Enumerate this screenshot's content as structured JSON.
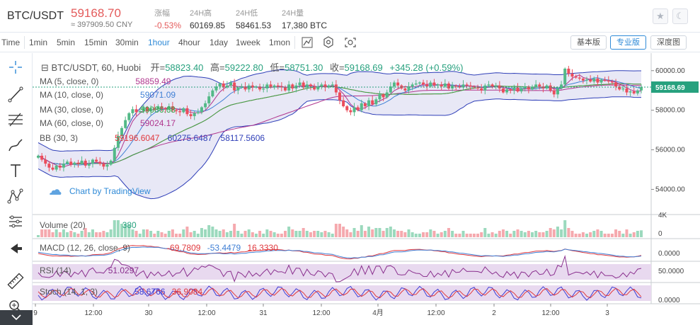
{
  "header": {
    "pair": "BTC/USDT",
    "last_price": "59168.70",
    "cny_price": "≈ 397909.50 CNY",
    "stats": [
      {
        "label": "涨幅",
        "value": "-0.53%"
      },
      {
        "label": "24H高",
        "value": "60169.85"
      },
      {
        "label": "24H低",
        "value": "58461.53"
      },
      {
        "label": "24H量",
        "value": "17,380 BTC"
      }
    ],
    "favorite_icon": "star-icon",
    "theme_icon": "moon-icon"
  },
  "toolbar": {
    "timeframes": [
      "Time",
      "1min",
      "5min",
      "15min",
      "30min",
      "1hour",
      "4hour",
      "1day",
      "1week",
      "1mon"
    ],
    "active_timeframe": "1hour",
    "icons": [
      "chart-type-icon",
      "settings-icon",
      "screenshot-icon"
    ],
    "views": [
      "基本版",
      "专业版",
      "深度图"
    ],
    "active_view": "专业版"
  },
  "left_tools": [
    "crosshair-icon",
    "trendline-icon",
    "fib-icon",
    "brush-icon",
    "text-icon",
    "pattern-icon",
    "measure-icon",
    "arrow-left-icon",
    "ruler-icon",
    "zoom-icon"
  ],
  "main_legend": {
    "symbol": "BTC/USDT, 60, Huobi",
    "open_label": "开=",
    "open": "58823.40",
    "high_label": "高=",
    "high": "59222.80",
    "low_label": "低=",
    "low": "58751.30",
    "close_label": "收=",
    "close": "59168.69",
    "change": "+345.28 (+0.59%)"
  },
  "indicators": [
    {
      "name": "MA (5, close, 0)",
      "values": [
        "58859.49"
      ],
      "colors": [
        "#b0368e"
      ]
    },
    {
      "name": "MA (10, close, 0)",
      "values": [
        "59071.09"
      ],
      "colors": [
        "#3f7fd5"
      ]
    },
    {
      "name": "MA (30, close, 0)",
      "values": [
        "59086.68"
      ],
      "colors": [
        "#38a84a"
      ]
    },
    {
      "name": "MA (60, close, 0)",
      "values": [
        "59024.17"
      ],
      "colors": [
        "#b0368e"
      ]
    },
    {
      "name": "BB (30, 3)",
      "values": [
        "59196.6047",
        "60275.6487",
        "58117.5606"
      ],
      "colors": [
        "#e0393e",
        "#2f3fb8",
        "#2f3fb8"
      ]
    }
  ],
  "watermark": "Chart by TradingView",
  "price_axis": {
    "ticks": [
      "60000.00",
      "58000.00",
      "56000.00",
      "54000.00"
    ],
    "current": "59168.69"
  },
  "sub_panes": [
    {
      "name": "Volume (20)",
      "values": [
        "380"
      ],
      "colors": [
        "#27a17e"
      ],
      "axis": [
        "4K",
        "0"
      ]
    },
    {
      "name": "MACD (12, 26, close, 9)",
      "values": [
        "-69.7809",
        "-53.4479",
        "16.3330"
      ],
      "colors": [
        "#e0393e",
        "#3f7fd5",
        "#e0393e"
      ],
      "axis": [
        "0.0000"
      ]
    },
    {
      "name": "RSI (14)",
      "values": [
        "51.0297"
      ],
      "colors": [
        "#8a2f8e"
      ],
      "axis": [
        "50.0000"
      ]
    },
    {
      "name": "Stoch (14, 1, 3)",
      "values": [
        "58.6766",
        "36.9084"
      ],
      "colors": [
        "#3f3fd5",
        "#e0393e"
      ],
      "axis": [
        "0.0000"
      ]
    }
  ],
  "time_axis": [
    "9",
    "12:00",
    "30",
    "12:00",
    "31",
    "12:00",
    "4月",
    "12:00",
    "2",
    "12:00",
    "3"
  ],
  "colors": {
    "up": "#53b987",
    "down": "#eb4d5c",
    "accent": "#2f8ad7",
    "bb_fill": "#d8d8f0"
  },
  "chart_data": {
    "type": "candlestick",
    "interval": "1hour",
    "price_range": [
      52800,
      60600
    ],
    "close_series": [
      55700,
      55500,
      55300,
      55100,
      55000,
      55200,
      55100,
      55300,
      55400,
      55250,
      55350,
      55300,
      55450,
      55200,
      55300,
      55500,
      55400,
      55300,
      55150,
      55250,
      55450,
      56100,
      56700,
      57100,
      57500,
      57850,
      58050,
      57900,
      57950,
      58150,
      57950,
      58100,
      58050,
      58200,
      58100,
      58050,
      58200,
      58000,
      57950,
      57900,
      58100,
      57800,
      57700,
      57850,
      57900,
      58150,
      58350,
      58700,
      59000,
      59200,
      59350,
      59150,
      59250,
      59400,
      59000,
      59150,
      59200,
      59050,
      59250,
      59150,
      59200,
      59050,
      59100,
      59300,
      59150,
      59250,
      59200,
      59150,
      59000,
      59300,
      59100,
      59250,
      59400,
      59150,
      59300,
      59200,
      59050,
      59200,
      59300,
      59150,
      59250,
      59300,
      58900,
      58500,
      58200,
      58000,
      57900,
      58150,
      58000,
      58350,
      58200,
      58500,
      58300,
      58550,
      58800,
      58650,
      58900,
      59200,
      59400,
      59250,
      59100,
      59000,
      59200,
      59300,
      59350,
      59400,
      59300,
      59200,
      59400,
      59250,
      59300,
      59200,
      59350,
      59100,
      59250,
      59200,
      59150,
      59300,
      59250,
      59200,
      59150,
      59100,
      59000,
      59250,
      59300,
      59200,
      59250,
      59100,
      58900,
      59050,
      59000,
      59150,
      58950,
      59100,
      59200,
      59050,
      59150,
      59300,
      59200,
      59100,
      59250,
      59000,
      58800,
      59100,
      59300,
      60100,
      59850,
      59700,
      59650,
      59600,
      59500,
      59550,
      59450,
      59600,
      59400,
      59550,
      59500,
      59450,
      59400,
      59200,
      59050,
      59100,
      58900,
      58950,
      58850,
      59000,
      59168
    ],
    "ma5_last": 58859.49,
    "ma10_last": 59071.09,
    "ma30_last": 59086.68,
    "ma60_last": 59024.17,
    "bb_last": {
      "mid": 59196.6047,
      "upper": 60275.6487,
      "lower": 58117.5606
    },
    "volume_last": 380,
    "macd_last": {
      "macd": -69.7809,
      "signal": -53.4479,
      "hist": 16.333
    },
    "rsi_last": 51.0297,
    "stoch_last": {
      "k": 58.6766,
      "d": 36.9084
    }
  }
}
